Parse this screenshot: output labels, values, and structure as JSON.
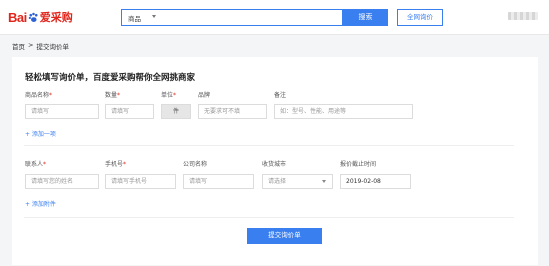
{
  "header": {
    "logo_latin": "Bai",
    "logo_cn": "爱采购",
    "search_category": "商品",
    "search_placeholder": "",
    "search_button": "搜索",
    "quote_button": "全网询价"
  },
  "breadcrumb": {
    "home": "首页",
    "sep": ">",
    "current": "提交询价单"
  },
  "form": {
    "title": "轻松填写询价单，百度爱采购帮你全网挑商家",
    "product": {
      "name_label": "商品名称",
      "name_placeholder": "请填写",
      "qty_label": "数量",
      "qty_placeholder": "请填写",
      "unit_label": "单位",
      "unit_value": "件",
      "brand_label": "品牌",
      "brand_placeholder": "无要求可不填",
      "note_label": "备注",
      "note_placeholder": "如：型号、性能、用途等"
    },
    "add_item": "+ 添加一项",
    "contact": {
      "name_label": "联系人",
      "name_placeholder": "请填写您的姓名",
      "phone_label": "手机号",
      "phone_placeholder": "请填写手机号",
      "company_label": "公司名称",
      "company_placeholder": "请填写",
      "city_label": "收货城市",
      "city_placeholder": "请选择",
      "deadline_label": "报价截止时间",
      "deadline_value": "2019-02-08"
    },
    "add_attachment": "+ 添加附件",
    "required_mark": "*",
    "submit": "提交询价单"
  },
  "colors": {
    "brand_red": "#e1251b",
    "accent_blue": "#3a7ff0"
  }
}
